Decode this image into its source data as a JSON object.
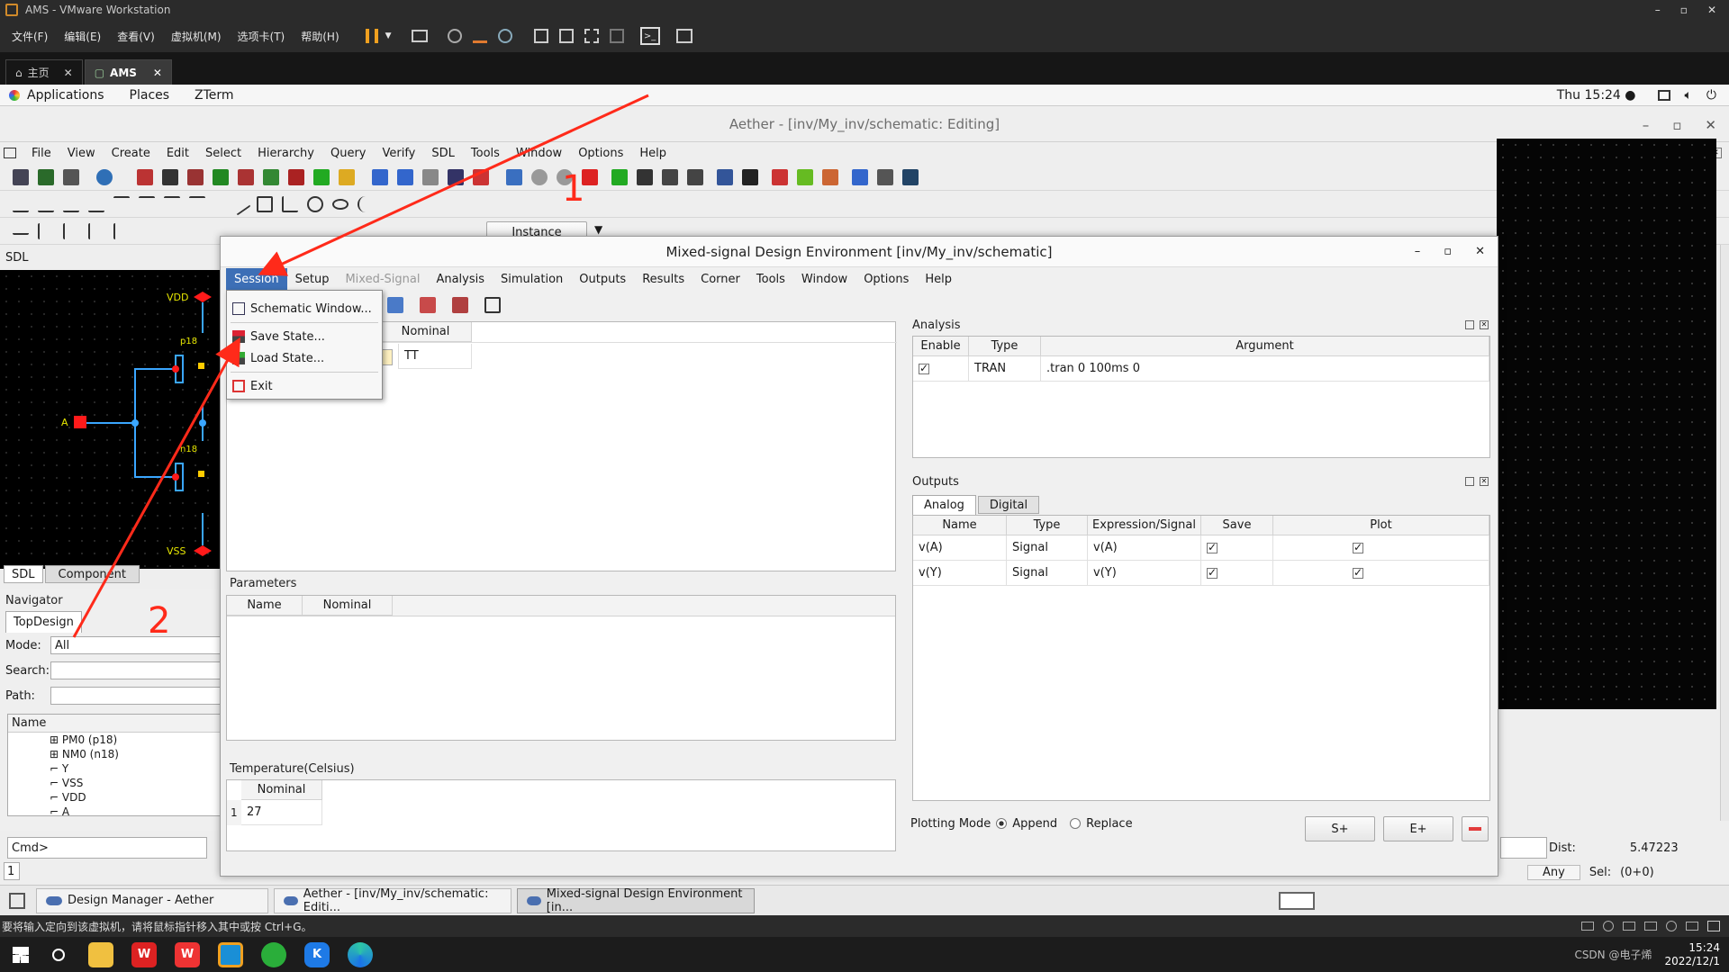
{
  "vmware": {
    "title": "AMS - VMware Workstation",
    "menu": [
      "文件(F)",
      "编辑(E)",
      "查看(V)",
      "虚拟机(M)",
      "选项卡(T)",
      "帮助(H)"
    ],
    "tabs": [
      {
        "label": "主页"
      },
      {
        "label": "AMS"
      }
    ],
    "status_text": "要将输入定向到该虚拟机，请将鼠标指针移入其中或按 Ctrl+G。"
  },
  "gnome": {
    "applications": "Applications",
    "places": "Places",
    "zterm": "ZTerm",
    "clock": "Thu 15:24 ●"
  },
  "aether": {
    "title": "Aether - [inv/My_inv/schematic: Editing]",
    "menu": [
      "File",
      "View",
      "Create",
      "Edit",
      "Select",
      "Hierarchy",
      "Query",
      "Verify",
      "SDL",
      "Tools",
      "Window",
      "Options",
      "Help"
    ],
    "instance_label": "Instance",
    "sdl_label": "SDL",
    "canvas_labels": {
      "vdd": "VDD",
      "vss": "VSS",
      "a": "A",
      "p18": "p18",
      "n18": "n18"
    },
    "left_tabs": [
      "SDL",
      "Component"
    ],
    "navigator": {
      "title": "Navigator",
      "tab": "TopDesign",
      "mode_label": "Mode:",
      "mode_value": "All",
      "search_label": "Search:",
      "path_label": "Path:",
      "name_header": "Name",
      "items": [
        "PM0 (p18)",
        "NM0 (n18)",
        "Y",
        "VSS",
        "VDD",
        "A"
      ]
    },
    "cmd_label": "Cmd>",
    "cmd_line": "1",
    "status": {
      "dist_label": "Dist:",
      "dist_value": "5.47223",
      "any": "Any",
      "sel_label": "Sel:",
      "sel_value": "(0+0)"
    }
  },
  "mde": {
    "title": "Mixed-signal Design Environment [inv/My_inv/schematic]",
    "menu": [
      "Session",
      "Setup",
      "Mixed-Signal",
      "Analysis",
      "Simulation",
      "Outputs",
      "Results",
      "Corner",
      "Tools",
      "Window",
      "Options",
      "Help"
    ],
    "corner": {
      "header": "Nominal",
      "value": "TT"
    },
    "parameters": {
      "title": "Parameters",
      "headers": [
        "Name",
        "Nominal"
      ]
    },
    "temperature": {
      "title": "Temperature(Celsius)",
      "header": "Nominal",
      "row_index": "1",
      "value": "27"
    },
    "analysis": {
      "title": "Analysis",
      "headers": [
        "Enable",
        "Type",
        "Argument"
      ],
      "rows": [
        {
          "enabled": true,
          "type": "TRAN",
          "argument": ".tran 0 100ms 0"
        }
      ]
    },
    "outputs": {
      "title": "Outputs",
      "tabs": [
        "Analog",
        "Digital"
      ],
      "headers": [
        "Name",
        "Type",
        "Expression/Signal",
        "Save",
        "Plot"
      ],
      "rows": [
        {
          "name": "v(A)",
          "type": "Signal",
          "expr": "v(A)",
          "save": true,
          "plot": true
        },
        {
          "name": "v(Y)",
          "type": "Signal",
          "expr": "v(Y)",
          "save": true,
          "plot": true
        }
      ]
    },
    "plotting": {
      "label": "Plotting Mode",
      "append": "Append",
      "replace": "Replace",
      "selected": "Append"
    },
    "buttons": {
      "s_plus": "S+",
      "e_plus": "E+"
    }
  },
  "session_menu": [
    "Schematic Window...",
    "Save State...",
    "Load State...",
    "Exit"
  ],
  "annotations": {
    "one": "1",
    "two": "2"
  },
  "guest_taskbar": [
    "Design Manager - Aether",
    "Aether - [inv/My_inv/schematic: Editi...",
    "Mixed-signal Design Environment [in..."
  ],
  "windows_tray": {
    "watermark": "CSDN @电子烯",
    "time": "15:24",
    "date": "2022/12/1"
  },
  "colors": {
    "accent": "#3d6fb6",
    "annotation": "#ff2a1a",
    "wire": "#3aa6ff",
    "pin": "#ff1a1a"
  }
}
